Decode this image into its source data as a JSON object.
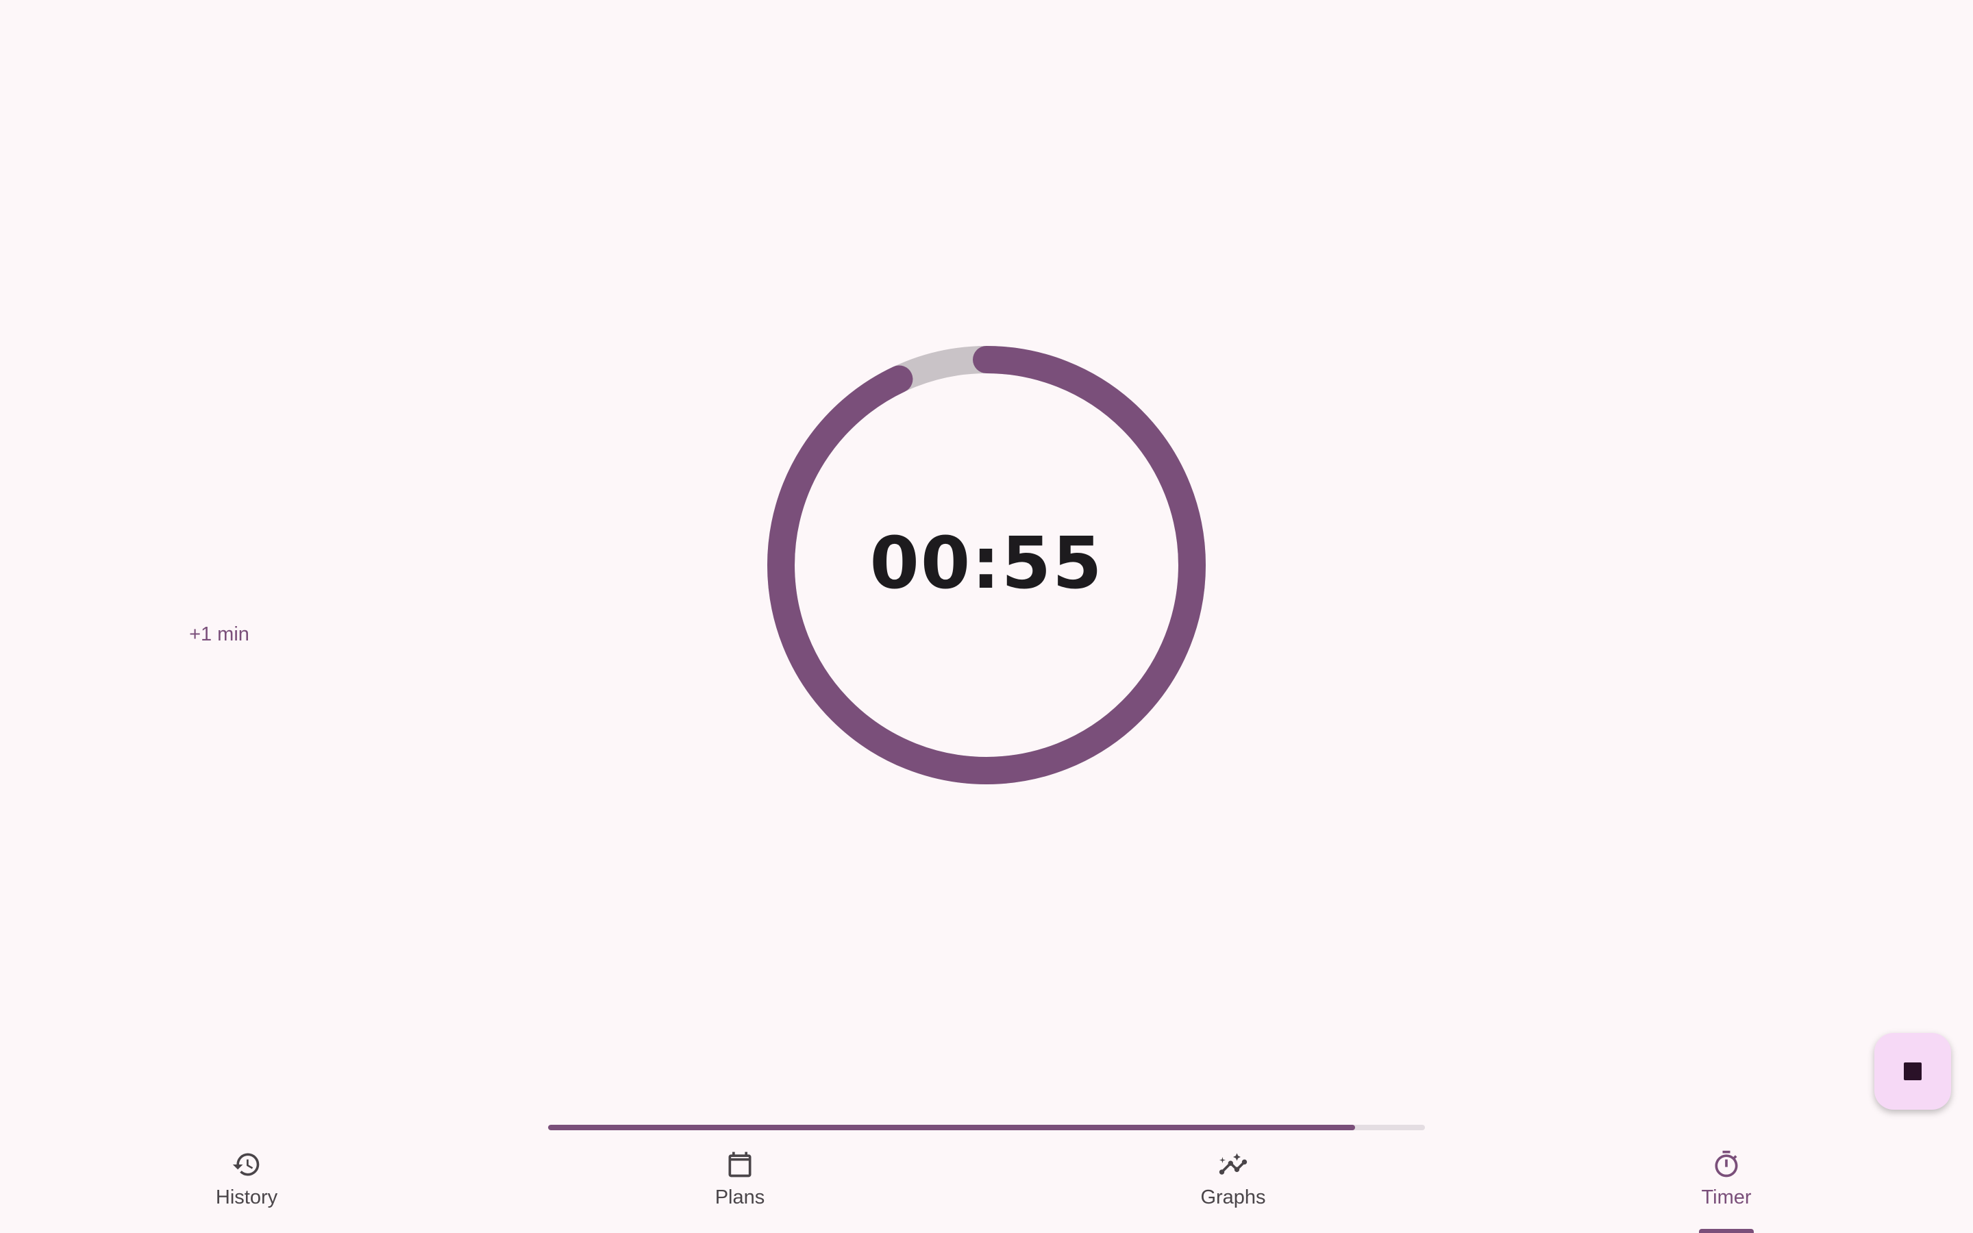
{
  "timer": {
    "display": "00:55",
    "add_minute_label": "+1 min",
    "progress_fraction": 0.93
  },
  "fab": {
    "icon": "stop-icon",
    "color": "#f6d9f6"
  },
  "progress_bar": {
    "fraction": 0.92
  },
  "nav": {
    "items": [
      {
        "label": "History",
        "icon": "history-icon"
      },
      {
        "label": "Plans",
        "icon": "calendar-icon"
      },
      {
        "label": "Graphs",
        "icon": "insights-icon"
      },
      {
        "label": "Timer",
        "icon": "timer-icon",
        "active": true
      }
    ]
  },
  "colors": {
    "accent": "#7a4f7a",
    "track": "#c9c3c7",
    "background": "#fdf7f9",
    "text": "#1d1b1e"
  }
}
